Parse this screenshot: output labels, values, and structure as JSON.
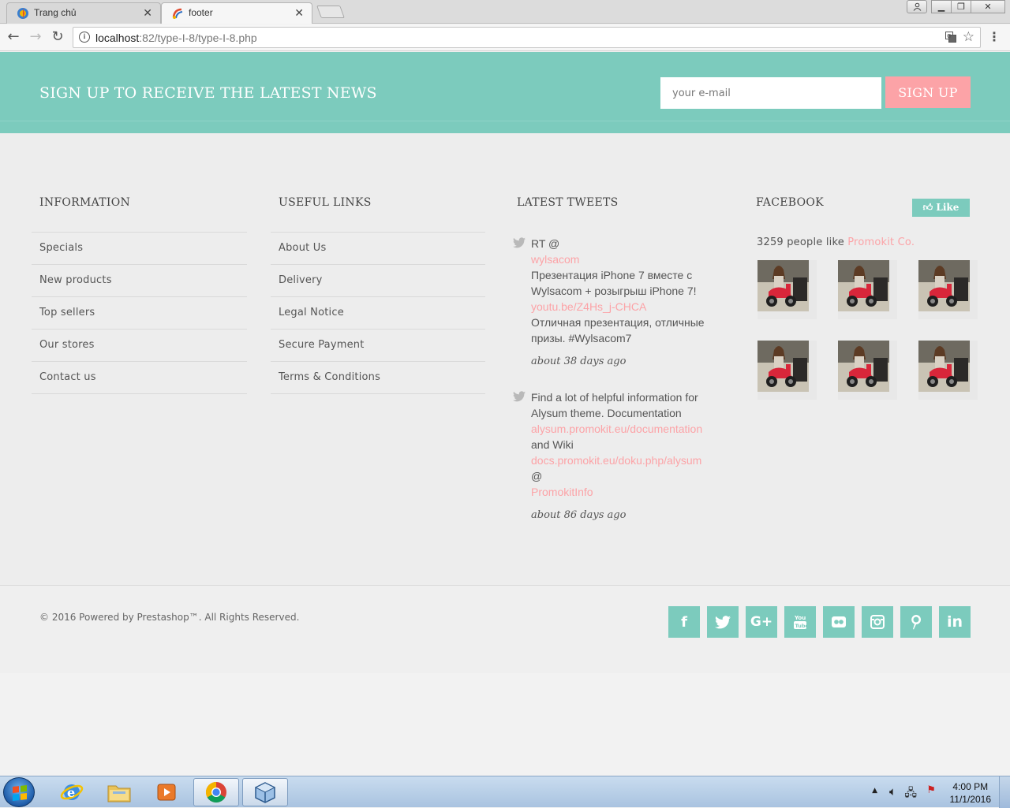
{
  "browser": {
    "tabs": [
      {
        "label": "Trang chủ",
        "active": false
      },
      {
        "label": "footer",
        "active": true
      }
    ],
    "url_host": "localhost",
    "url_rest": ":82/type-I-8/type-I-8.php"
  },
  "newsletter": {
    "title": "SIGN UP TO RECEIVE THE LATEST NEWS",
    "placeholder": "your e-mail",
    "button": "SIGN UP"
  },
  "information": {
    "title": "INFORMATION",
    "links": [
      "Specials",
      "New products",
      "Top sellers",
      "Our stores",
      "Contact us"
    ]
  },
  "useful_links": {
    "title": "USEFUL LINKS",
    "links": [
      "About Us",
      "Delivery",
      "Legal Notice",
      "Secure Payment",
      "Terms & Conditions"
    ]
  },
  "tweets": {
    "title": "LATEST TWEETS",
    "items": [
      {
        "lines": [
          {
            "text": "RT @",
            "link": false
          },
          {
            "text": "wylsacom",
            "link": true
          },
          {
            "text": "Презентация iPhone 7 вместе с Wylsacom + розыгрыш iPhone 7!",
            "link": false
          },
          {
            "text": "youtu.be/Z4Hs_j-CHCA",
            "link": true
          },
          {
            "text": "Отличная презентация, отличные призы. #Wylsacom7",
            "link": false
          }
        ],
        "when": "about 38 days ago"
      },
      {
        "lines": [
          {
            "text": "Find a lot of helpful information for Alysum theme. Documentation",
            "link": false
          },
          {
            "text": "alysum.promokit.eu/documentation",
            "link": true
          },
          {
            "text": "and Wiki",
            "link": false
          },
          {
            "text": "docs.promokit.eu/doku.php/alysum",
            "link": true
          },
          {
            "text": "@",
            "link": false
          },
          {
            "text": "PromokitInfo",
            "link": true
          }
        ],
        "when": "about 86 days ago"
      }
    ]
  },
  "facebook": {
    "title": "FACEBOOK",
    "like_label": "Like",
    "count_text": "3259 people like",
    "brand": "Promokit Co."
  },
  "bottom": {
    "copyright": "© 2016 Powered by Prestashop™. All Rights Reserved.",
    "social": [
      "facebook",
      "twitter",
      "google-plus",
      "youtube",
      "flickr",
      "instagram",
      "pinterest",
      "linkedin"
    ]
  },
  "taskbar": {
    "time": "4:00 PM",
    "date": "11/1/2016"
  },
  "colors": {
    "accent": "#7ccbbd",
    "pink": "#fca3a7"
  }
}
